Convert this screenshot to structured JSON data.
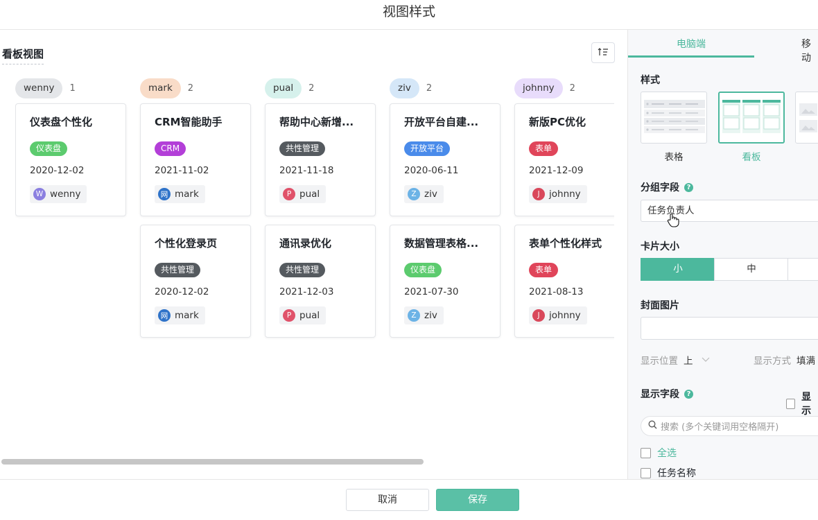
{
  "dialog": {
    "title": "视图样式"
  },
  "left_pane": {
    "title": "看板视图",
    "sort_icon": "sort-ascending-icon"
  },
  "columns": [
    {
      "name": "wenny",
      "count": "1",
      "color": "#e4e6e9",
      "cards": [
        {
          "title": "仪表盘个性化",
          "tag": "仪表盘",
          "tag_color": "#5ccb6e",
          "date": "2020-12-02",
          "user": "wenny",
          "avatar": "W",
          "avatar_color": "#8b7fe0"
        }
      ]
    },
    {
      "name": "mark",
      "count": "2",
      "color": "#f9dcc8",
      "cards": [
        {
          "title": "CRM智能助手",
          "tag": "CRM",
          "tag_color": "#b33fd8",
          "date": "2021-11-02",
          "user": "mark",
          "avatar": "网",
          "avatar_color": "#2f73c9"
        },
        {
          "title": "个性化登录页",
          "tag": "共性管理",
          "tag_color": "#555a5f",
          "date": "2020-12-02",
          "user": "mark",
          "avatar": "网",
          "avatar_color": "#2f73c9"
        }
      ]
    },
    {
      "name": "pual",
      "count": "2",
      "color": "#d6f1ec",
      "cards": [
        {
          "title": "帮助中心新增...",
          "tag": "共性管理",
          "tag_color": "#555a5f",
          "date": "2021-11-18",
          "user": "pual",
          "avatar": "P",
          "avatar_color": "#e0526a"
        },
        {
          "title": "通讯录优化",
          "tag": "共性管理",
          "tag_color": "#555a5f",
          "date": "2021-12-03",
          "user": "pual",
          "avatar": "P",
          "avatar_color": "#e0526a"
        }
      ]
    },
    {
      "name": "ziv",
      "count": "2",
      "color": "#d5e7f8",
      "cards": [
        {
          "title": "开放平台自建...",
          "tag": "开放平台",
          "tag_color": "#4a8bea",
          "date": "2020-06-11",
          "user": "ziv",
          "avatar": "Z",
          "avatar_color": "#6cb3e6"
        },
        {
          "title": "数据管理表格...",
          "tag": "仪表盘",
          "tag_color": "#5ccb6e",
          "date": "2021-07-30",
          "user": "ziv",
          "avatar": "Z",
          "avatar_color": "#6cb3e6"
        }
      ]
    },
    {
      "name": "johnny",
      "count": "2",
      "color": "#e8dcfb",
      "cards": [
        {
          "title": "新版PC优化",
          "tag": "表单",
          "tag_color": "#e0455a",
          "date": "2021-12-09",
          "user": "johnny",
          "avatar": "J",
          "avatar_color": "#d9485b"
        },
        {
          "title": "表单个性化样式",
          "tag": "表单",
          "tag_color": "#e0455a",
          "date": "2021-08-13",
          "user": "johnny",
          "avatar": "J",
          "avatar_color": "#d9485b"
        }
      ]
    }
  ],
  "right_pane": {
    "tabs": [
      "电脑端",
      "移动"
    ],
    "style_label": "样式",
    "style_options": [
      "表格",
      "看板"
    ],
    "group_field_label": "分组字段",
    "group_field_value": "任务负责人",
    "card_size_label": "卡片大小",
    "card_sizes": [
      "小",
      "中"
    ],
    "cover_label": "封面图片",
    "position_label": "显示位置",
    "position_value": "上",
    "mode_label": "显示方式",
    "mode_value": "填满",
    "fields_label": "显示字段",
    "show_label": "显示",
    "search_placeholder": "搜索 (多个关键词用空格隔开)",
    "select_all": "全选",
    "field_task_name": "任务名称"
  },
  "footer": {
    "cancel": "取消",
    "save": "保存"
  },
  "theme": {
    "accent": "#4cb89d"
  }
}
